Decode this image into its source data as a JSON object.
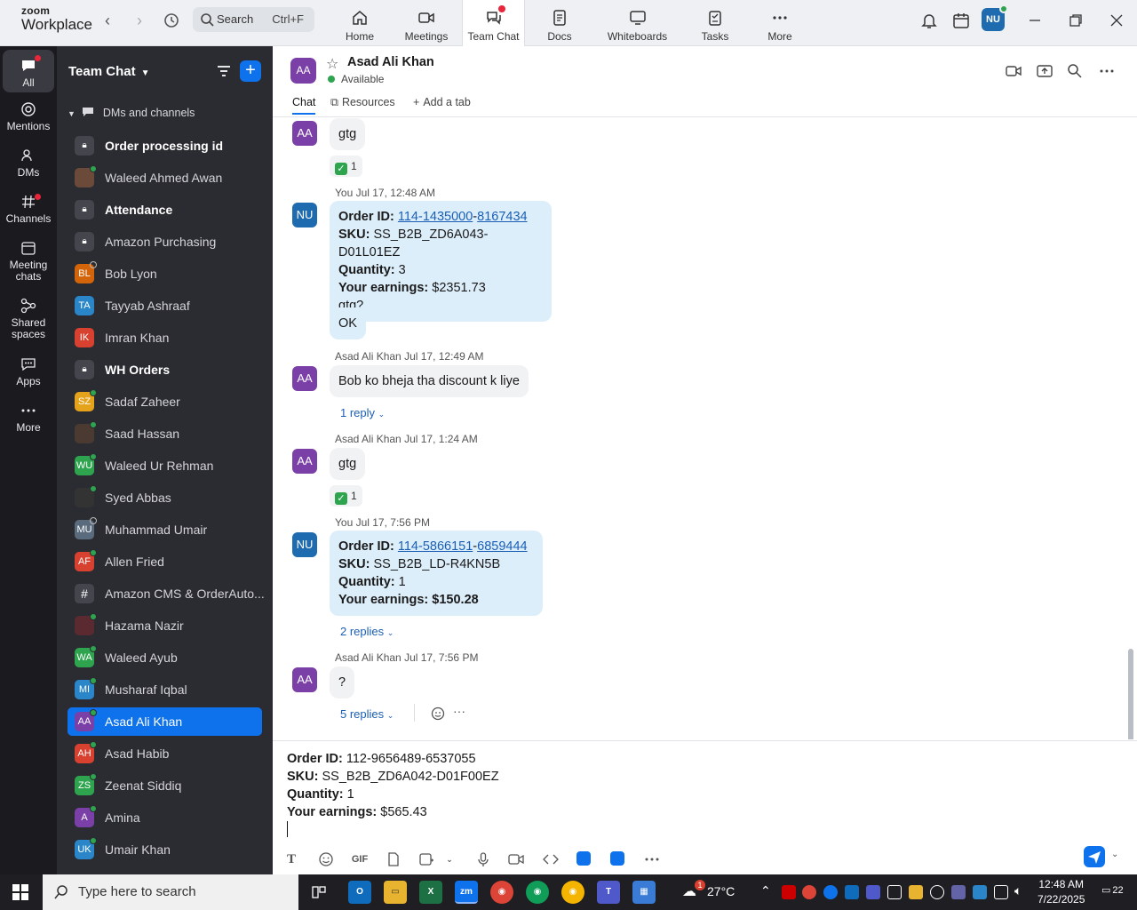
{
  "brand": {
    "line1": "zoom",
    "line2": "Workplace"
  },
  "search": {
    "label": "Search",
    "shortcut": "Ctrl+F"
  },
  "topnav": [
    {
      "label": "Home",
      "icon": "home-icon"
    },
    {
      "label": "Meetings",
      "icon": "video-camera-icon"
    },
    {
      "label": "Team Chat",
      "icon": "chat-bubbles-icon",
      "active": true
    },
    {
      "label": "Docs",
      "icon": "document-icon"
    },
    {
      "label": "Whiteboards",
      "icon": "whiteboard-icon"
    },
    {
      "label": "Tasks",
      "icon": "tasks-icon"
    },
    {
      "label": "More",
      "icon": "more-dots-icon"
    }
  ],
  "user_avatar": "NU",
  "rail": [
    {
      "label": "All",
      "active": true
    },
    {
      "label": "Mentions"
    },
    {
      "label": "DMs"
    },
    {
      "label": "Channels"
    },
    {
      "label": "Meeting chats"
    },
    {
      "label": "Shared spaces"
    },
    {
      "label": "Apps"
    },
    {
      "label": "More"
    }
  ],
  "sidebar": {
    "title": "Team Chat",
    "section": "DMs and channels",
    "items": [
      {
        "name": "Order processing id",
        "type": "lock",
        "bold": true
      },
      {
        "name": "Waleed Ahmed Awan",
        "type": "photo",
        "color": "#6b4a3a",
        "status": "online"
      },
      {
        "name": "Attendance",
        "type": "lock",
        "bold": true
      },
      {
        "name": "Amazon Purchasing",
        "type": "lock"
      },
      {
        "name": "Bob Lyon",
        "initials": "BL",
        "color": "#d4640a",
        "status": "offline"
      },
      {
        "name": "Tayyab Ashraaf",
        "initials": "TA",
        "color": "#2a86c9"
      },
      {
        "name": "Imran Khan",
        "initials": "IK",
        "color": "#d8402f"
      },
      {
        "name": "WH Orders",
        "type": "lock",
        "bold": true
      },
      {
        "name": "Sadaf Zaheer",
        "initials": "SZ",
        "color": "#e5a21b",
        "status": "online"
      },
      {
        "name": "Saad Hassan",
        "type": "photo",
        "color": "#4a3a32",
        "status": "online"
      },
      {
        "name": "Waleed Ur Rehman",
        "initials": "WU",
        "color": "#2ea44f",
        "status": "online"
      },
      {
        "name": "Syed Abbas",
        "type": "photo",
        "color": "#333",
        "status": "online"
      },
      {
        "name": "Muhammad Umair",
        "initials": "MU",
        "color": "#5a6b7d",
        "status": "offline"
      },
      {
        "name": "Allen Fried",
        "initials": "AF",
        "color": "#d8402f",
        "status": "online"
      },
      {
        "name": "Amazon CMS & OrderAuto...",
        "type": "hash"
      },
      {
        "name": "Hazama Nazir",
        "type": "photo",
        "color": "#5a2a30",
        "status": "online"
      },
      {
        "name": "Waleed Ayub",
        "initials": "WA",
        "color": "#2ea44f",
        "status": "online"
      },
      {
        "name": "Musharaf Iqbal",
        "initials": "MI",
        "color": "#2a86c9",
        "status": "online"
      },
      {
        "name": "Asad Ali Khan",
        "initials": "AA",
        "color": "#7b3fa8",
        "status": "online",
        "selected": true
      },
      {
        "name": "Asad Habib",
        "initials": "AH",
        "color": "#d8402f",
        "status": "online"
      },
      {
        "name": "Zeenat Siddiq",
        "initials": "ZS",
        "color": "#2ea44f",
        "status": "online"
      },
      {
        "name": "Amina",
        "initials": "A",
        "color": "#7b3fa8",
        "status": "online"
      },
      {
        "name": "Umair Khan",
        "initials": "UK",
        "color": "#2a86c9",
        "status": "online"
      }
    ]
  },
  "chat_header": {
    "avatar": "AA",
    "name": "Asad Ali Khan",
    "status": "Available",
    "tabs": [
      "Chat",
      "Resources",
      "Add a tab"
    ]
  },
  "messages": {
    "m1_text": "gtg",
    "m1_react": "1",
    "m2_meta": "You Jul 17, 12:48 AM",
    "m2_label_order": "Order ID:",
    "m2_link_a": "114-1435000",
    "m2_link_sep": "-",
    "m2_link_b": "8167434",
    "m2_label_sku": "SKU:",
    "m2_sku": "SS_B2B_ZD6A043-D01L01EZ",
    "m2_label_qty": "Quantity:",
    "m2_qty": "3",
    "m2_label_earn": "Your earnings:",
    "m2_earn": "$2351.73",
    "m2_tail": "gtg?",
    "m3_text": "OK",
    "m4_sender": "Asad Ali Khan",
    "m4_time": "Jul 17, 12:49 AM",
    "m4_text": "Bob ko bheja tha discount k liye",
    "m4_replies": "1 reply",
    "m5_sender": "Asad Ali Khan",
    "m5_time": "Jul 17, 1:24 AM",
    "m5_text": "gtg",
    "m5_react": "1",
    "m6_meta": "You Jul 17, 7:56 PM",
    "m6_link_a": "114-5866151",
    "m6_link_b": "6859444",
    "m6_sku": "SS_B2B_LD-R4KN5B",
    "m6_qty": "1",
    "m6_earn": "$150.28",
    "m6_replies": "2 replies",
    "m7_sender": "Asad Ali Khan",
    "m7_time": "Jul 17, 7:56 PM",
    "m7_text": "?",
    "m7_replies": "5 replies"
  },
  "compose": {
    "label_order": "Order ID:",
    "order": "112-9656489-6537055",
    "label_sku": "SKU:",
    "sku": "SS_B2B_ZD6A042-D01F00EZ",
    "label_qty": "Quantity:",
    "qty": "1",
    "label_earn": "Your earnings:",
    "earn": "$565.43",
    "gif_label": "GIF"
  },
  "taskbar": {
    "search_placeholder": "Type here to search",
    "weather": "27°C",
    "weather_badge": "1",
    "time": "12:48 AM",
    "date": "7/22/2025",
    "notifications": "22"
  }
}
